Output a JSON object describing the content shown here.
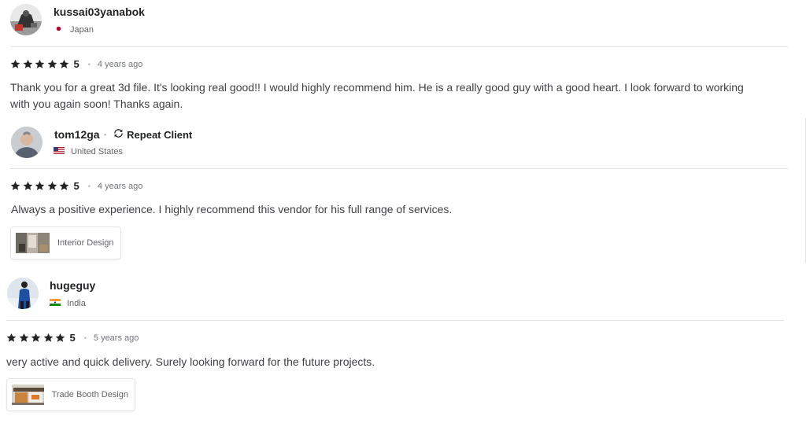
{
  "reviews": [
    {
      "username": "kussai03yanabok",
      "country": "Japan",
      "flag_icon": "japan-flag-icon",
      "rating": "5",
      "time": "4 years ago",
      "text": "Thank you for a great 3d file. It's looking real good!! I would highly recommend him. He is a really good guy with a good heart. I look forward to working with you again soon! Thanks again."
    },
    {
      "username": "tom12ga",
      "badge": "Repeat Client",
      "badge_icon": "repeat-icon",
      "country": "United States",
      "flag_icon": "usa-flag-icon",
      "rating": "5",
      "time": "4 years ago",
      "text": "Always a positive experience. I highly recommend this vendor for his full range of services.",
      "tag": "Interior Design"
    },
    {
      "username": "hugeguy",
      "country": "India",
      "flag_icon": "india-flag-icon",
      "rating": "5",
      "time": "5 years ago",
      "text": "very active and quick delivery. Surely looking forward for the future projects.",
      "tag": "Trade Booth Design"
    }
  ],
  "colors": {
    "text": "#404145",
    "heading": "#222325",
    "muted": "#74767e",
    "divider": "#e4e5e7",
    "star": "#222325"
  }
}
